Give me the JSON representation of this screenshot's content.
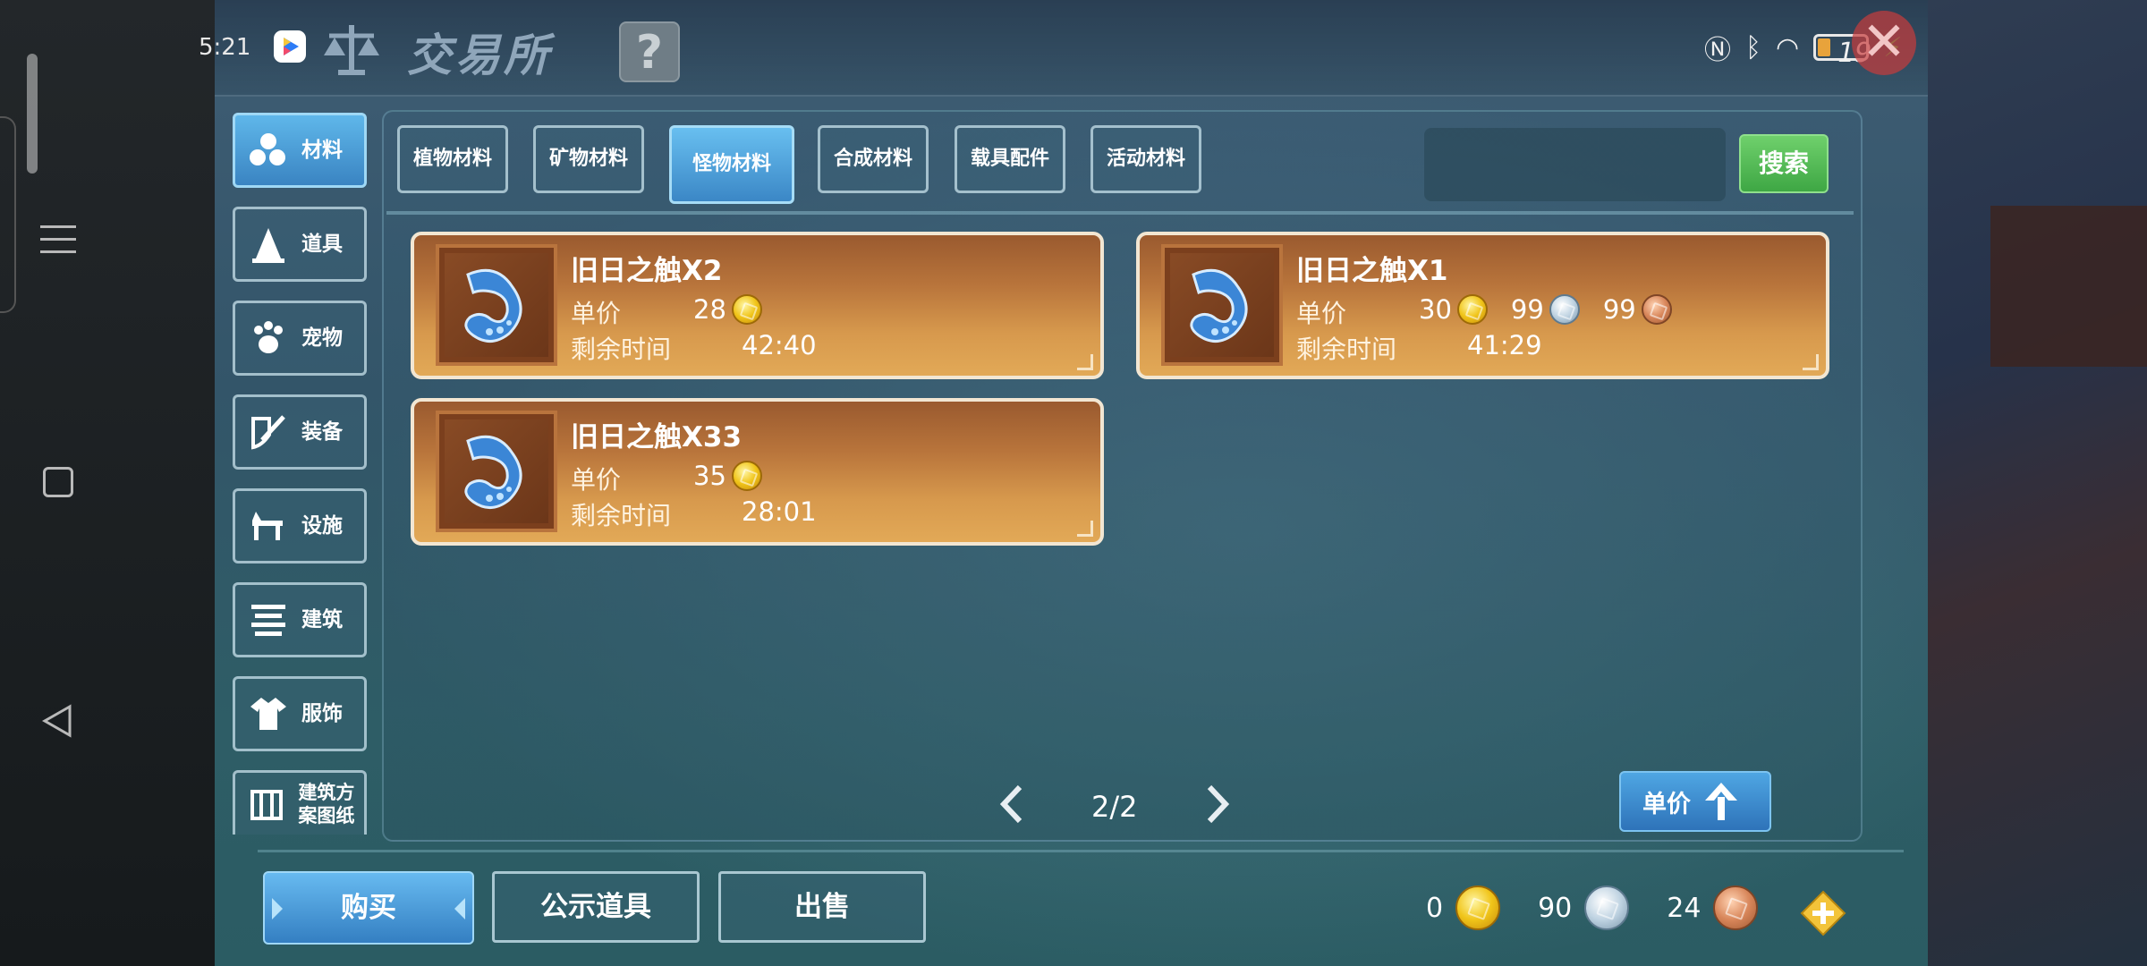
{
  "status_bar": {
    "time": "5:21",
    "battery_level": "19"
  },
  "window": {
    "title": "交易所",
    "help_label": "?"
  },
  "categories": [
    {
      "label": "材料",
      "icon": "materials-icon",
      "active": true
    },
    {
      "label": "道具",
      "icon": "tool-icon",
      "active": false
    },
    {
      "label": "宠物",
      "icon": "paw-icon",
      "active": false
    },
    {
      "label": "装备",
      "icon": "equipment-icon",
      "active": false
    },
    {
      "label": "设施",
      "icon": "facility-icon",
      "active": false
    },
    {
      "label": "建筑",
      "icon": "building-icon",
      "active": false
    },
    {
      "label": "服饰",
      "icon": "clothing-icon",
      "active": false
    },
    {
      "label": "建筑方案图纸",
      "icon": "blueprint-icon",
      "active": false
    }
  ],
  "subtabs": [
    {
      "label": "植物材料",
      "active": false
    },
    {
      "label": "矿物材料",
      "active": false
    },
    {
      "label": "怪物材料",
      "active": true
    },
    {
      "label": "合成材料",
      "active": false
    },
    {
      "label": "载具配件",
      "active": false
    },
    {
      "label": "活动材料",
      "active": false
    }
  ],
  "search": {
    "button_label": "搜索",
    "value": ""
  },
  "listings": [
    {
      "name": "旧日之触X2",
      "price_label": "单价",
      "price": {
        "gold": "28"
      },
      "time_label": "剩余时间",
      "time_left": "42:40"
    },
    {
      "name": "旧日之触X1",
      "price_label": "单价",
      "price": {
        "gold": "30",
        "silver": "99",
        "bronze": "99"
      },
      "time_label": "剩余时间",
      "time_left": "41:29"
    },
    {
      "name": "旧日之触X33",
      "price_label": "单价",
      "price": {
        "gold": "35"
      },
      "time_label": "剩余时间",
      "time_left": "28:01"
    }
  ],
  "pager": {
    "text": "2/2"
  },
  "sort": {
    "label": "单价"
  },
  "actions": {
    "buy": "购买",
    "publicity": "公示道具",
    "sell": "出售"
  },
  "wallet": {
    "gold": "0",
    "silver": "90",
    "bronze": "24"
  },
  "colors": {
    "active_tab": "#3b87c6",
    "search_button": "#3ea744",
    "card_top": "#9a5a2f",
    "card_bottom": "#e2a957"
  }
}
